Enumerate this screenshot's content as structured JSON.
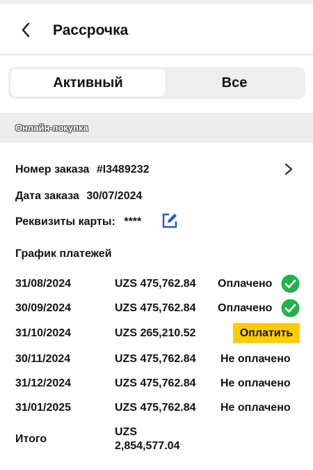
{
  "header": {
    "title": "Рассрочка",
    "back_icon": "chevron-left-icon"
  },
  "tabs": [
    {
      "label": "Активный",
      "active": true
    },
    {
      "label": "Все",
      "active": false
    }
  ],
  "section": {
    "label": "Онлайн-покупка"
  },
  "order": {
    "number_label": "Номер заказа",
    "number_value": "#I3489232",
    "date_label": "Дата заказа",
    "date_value": "30/07/2024",
    "card_label": "Реквизиты карты:",
    "card_value": "****"
  },
  "schedule": {
    "title": "График платежей",
    "rows": [
      {
        "date": "31/08/2024",
        "amount": "UZS 475,762.84",
        "status": "Оплачено",
        "state": "paid"
      },
      {
        "date": "30/09/2024",
        "amount": "UZS 475,762.84",
        "status": "Оплачено",
        "state": "paid"
      },
      {
        "date": "31/10/2024",
        "amount": "UZS 265,210.52",
        "status": "Оплатить",
        "state": "due"
      },
      {
        "date": "30/11/2024",
        "amount": "UZS 475,762.84",
        "status": "Не оплачено",
        "state": "unpaid"
      },
      {
        "date": "31/12/2024",
        "amount": "UZS 475,762.84",
        "status": "Не оплачено",
        "state": "unpaid"
      },
      {
        "date": "31/01/2025",
        "amount": "UZS 475,762.84",
        "status": "Не оплачено",
        "state": "unpaid"
      }
    ]
  },
  "total": {
    "label": "Итого",
    "currency": "UZS",
    "value": "2,854,577.04"
  },
  "colors": {
    "accent": "#ffcc00",
    "paid_green": "#21b34a"
  }
}
